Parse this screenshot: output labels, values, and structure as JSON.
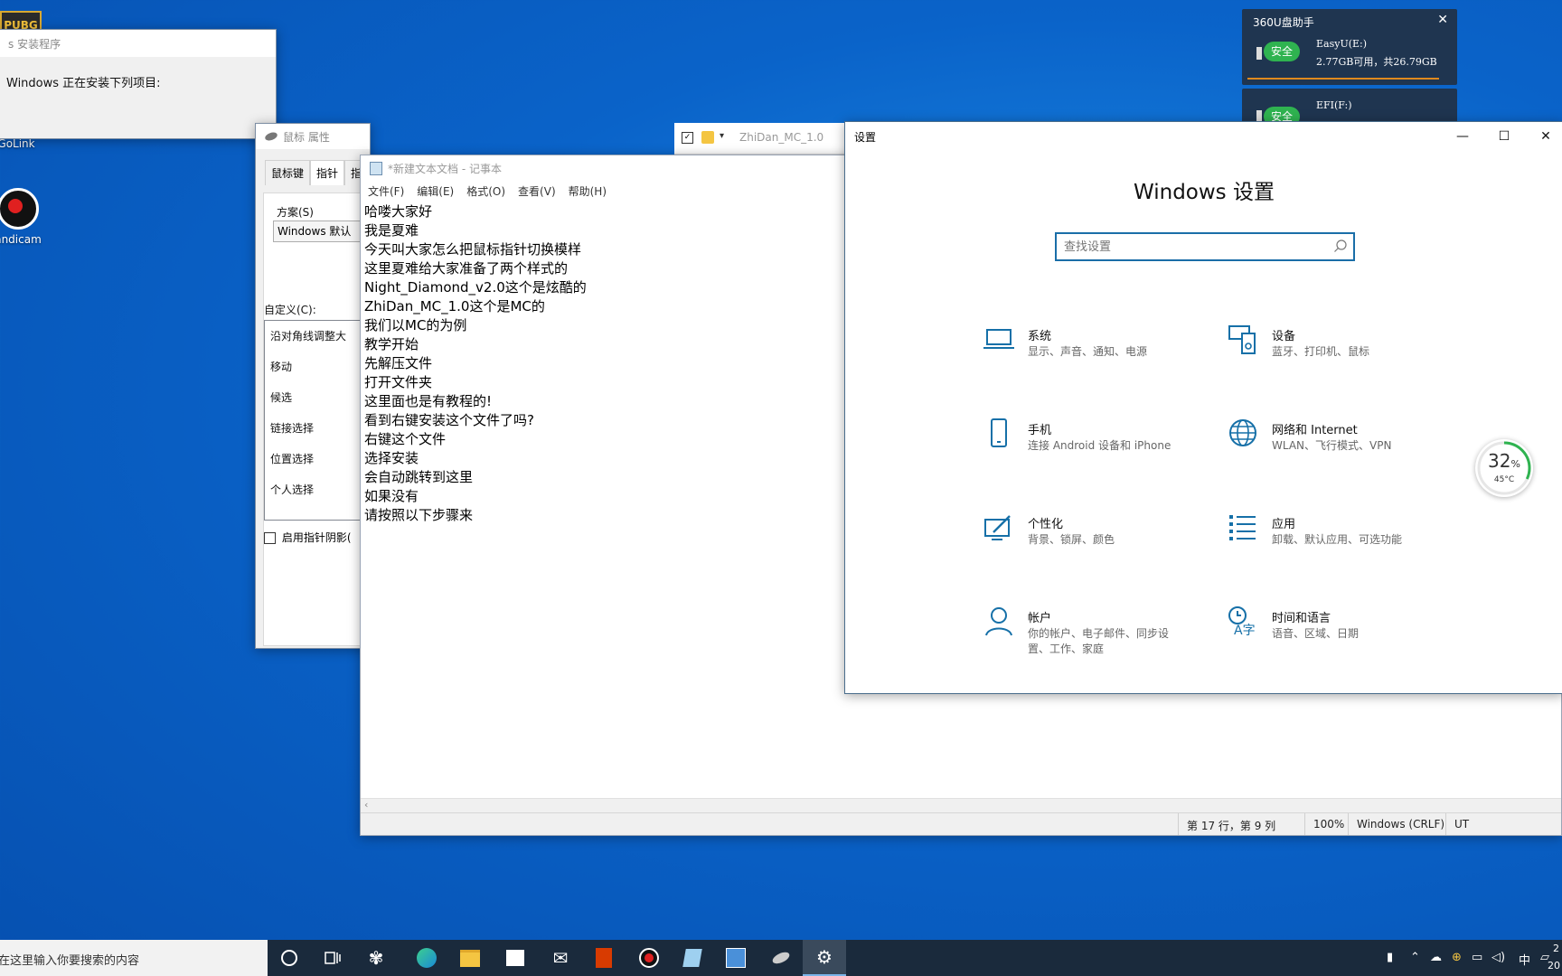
{
  "desktop": {
    "icons": [
      {
        "label": "GoLink"
      },
      {
        "label": "andicam"
      }
    ],
    "pubg_label": "PUBG"
  },
  "installer": {
    "title": "s 安装程序",
    "message": "Windows 正在安装下列项目:"
  },
  "mouse_props": {
    "title": "鼠标 属性",
    "tabs": [
      "鼠标键",
      "指针",
      "指"
    ],
    "scheme_label": "方案(S)",
    "scheme_value": "Windows 默认",
    "custom_label": "自定义(C):",
    "items": [
      "沿对角线调整大",
      "移动",
      "候选",
      "链接选择",
      "位置选择",
      "个人选择"
    ],
    "shadow_checkbox": "启用指针阴影("
  },
  "explorer_strip": {
    "path": "ZhiDan_MC_1.0"
  },
  "notepad": {
    "title": "*新建文本文档 - 记事本",
    "menu": [
      "文件(F)",
      "编辑(E)",
      "格式(O)",
      "查看(V)",
      "帮助(H)"
    ],
    "lines": [
      "哈喽大家好",
      "我是夏难",
      "今天叫大家怎么把鼠标指针切换模样",
      "这里夏难给大家准备了两个样式的",
      "Night_Diamond_v2.0这个是炫酷的",
      "ZhiDan_MC_1.0这个是MC的",
      "我们以MC的为例",
      "教学开始",
      "先解压文件",
      "打开文件夹",
      "这里面也是有教程的!",
      "看到右键安装这个文件了吗?",
      "右键这个文件",
      "选择安装",
      "会自动跳转到这里",
      "如果没有",
      "请按照以下步骤来"
    ],
    "status": {
      "position": "第 17 行，第 9 列",
      "zoom": "100%",
      "line_ending": "Windows (CRLF)",
      "encoding": "UT"
    }
  },
  "settings": {
    "window_title": "设置",
    "heading": "Windows 设置",
    "search_placeholder": "查找设置",
    "categories": [
      {
        "icon": "laptop-icon",
        "title": "系统",
        "desc": "显示、声音、通知、电源"
      },
      {
        "icon": "devices-icon",
        "title": "设备",
        "desc": "蓝牙、打印机、鼠标"
      },
      {
        "icon": "phone-icon",
        "title": "手机",
        "desc": "连接 Android 设备和 iPhone"
      },
      {
        "icon": "globe-icon",
        "title": "网络和 Internet",
        "desc": "WLAN、飞行模式、VPN"
      },
      {
        "icon": "personalize-icon",
        "title": "个性化",
        "desc": "背景、锁屏、颜色"
      },
      {
        "icon": "apps-icon",
        "title": "应用",
        "desc": "卸载、默认应用、可选功能"
      },
      {
        "icon": "person-icon",
        "title": "帐户",
        "desc": "你的帐户、电子邮件、同步设置、工作、家庭"
      },
      {
        "icon": "time-language-icon",
        "title": "时间和语言",
        "desc": "语音、区域、日期"
      }
    ]
  },
  "widget_360": {
    "title": "360U盘助手",
    "drive1": {
      "badge": "安全",
      "name": "EasyU(E:)",
      "info": "2.77GB可用，共26.79GB"
    },
    "drive2": {
      "badge": "安全",
      "name": "EFI(F:)"
    }
  },
  "temp_gauge": {
    "percent": "32",
    "percent_unit": "%",
    "temp": "45°C",
    "level": 0.32
  },
  "taskbar": {
    "search_text": "在这里输入你要搜索的内容",
    "ime": "中",
    "clock_top": "2",
    "clock_bottom": "20"
  },
  "colors": {
    "accent": "#1a6ea8",
    "settings_icon": "#1670a8",
    "badge_green": "#2fb350",
    "taskbar": "#1a2a3c"
  }
}
